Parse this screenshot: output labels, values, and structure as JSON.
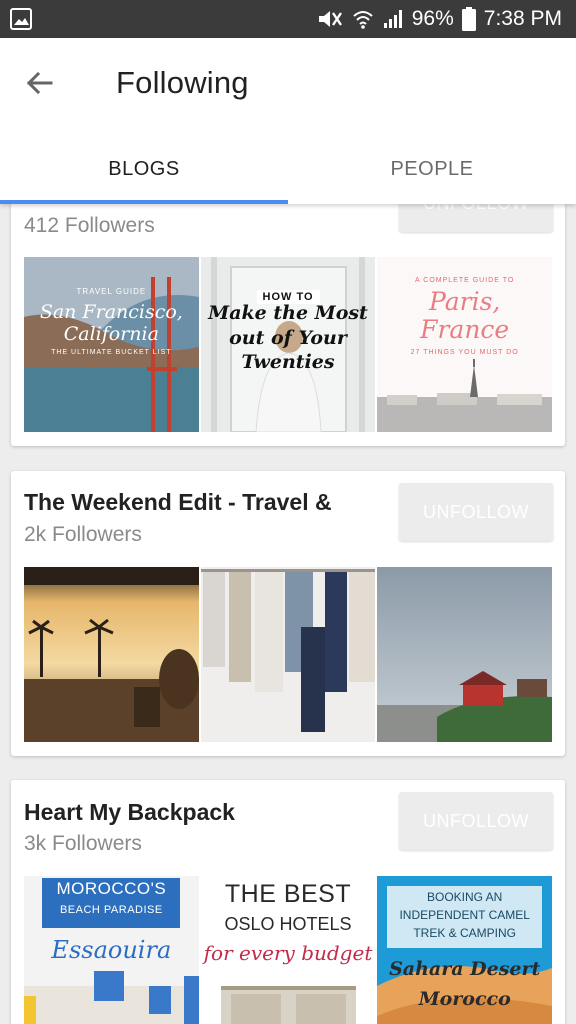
{
  "status_bar": {
    "battery_percent": "96%",
    "time": "7:38 PM"
  },
  "header": {
    "title": "Following",
    "tabs": [
      {
        "label": "BLOGS",
        "selected": true
      },
      {
        "label": "PEOPLE",
        "selected": false
      }
    ]
  },
  "cards": [
    {
      "name": "",
      "followers": "412 Followers",
      "button": "UNFOLLOW",
      "thumbs": [
        {
          "line1": "TRAVEL GUIDE",
          "line2": "San Francisco,",
          "line3": "California",
          "line4": "THE ULTIMATE BUCKET LIST"
        },
        {
          "line1": "HOW TO",
          "line2": "Make the Most",
          "line3": "out of Your",
          "line4": "Twenties"
        },
        {
          "line1": "A COMPLETE GUIDE TO",
          "line2": "Paris,",
          "line3": "France",
          "line4": "27 THINGS YOU MUST DO"
        }
      ]
    },
    {
      "name": "The Weekend Edit - Travel &",
      "followers": "2k Followers",
      "button": "UNFOLLOW"
    },
    {
      "name": "Heart My Backpack",
      "followers": "3k Followers",
      "button": "UNFOLLOW",
      "thumbs": [
        {
          "line1": "MOROCCO'S",
          "line2": "BEACH PARADISE",
          "line3": "Essaouira"
        },
        {
          "line1": "THE BEST",
          "line2": "OSLO HOTELS",
          "line3": "for every budget"
        },
        {
          "line1": "BOOKING AN",
          "line2": "INDEPENDENT CAMEL",
          "line3": "TREK & CAMPING",
          "line4": "Sahara Desert",
          "line5": "Morocco"
        }
      ]
    }
  ],
  "colors": {
    "status_bar": "#3b3b3b",
    "tab_indicator": "#4a8cf0",
    "button_bg": "#ececec"
  }
}
